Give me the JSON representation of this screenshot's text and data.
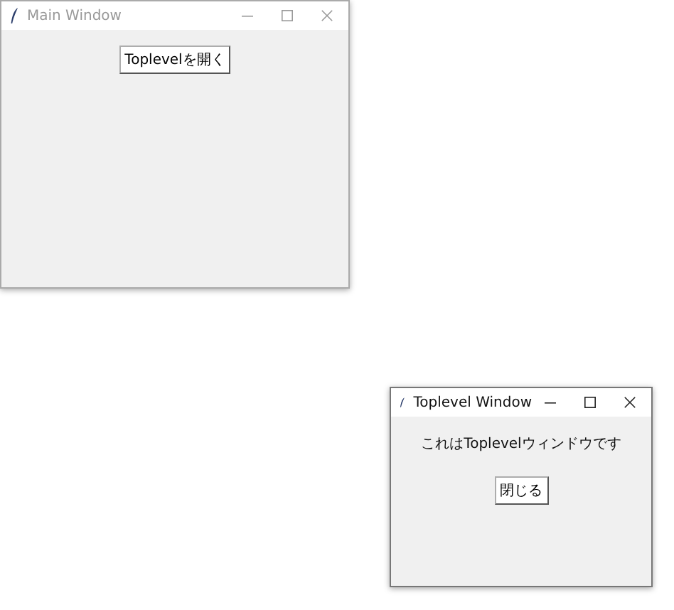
{
  "windows": [
    {
      "title": "Main Window",
      "active": false,
      "content": [
        {
          "kind": "button",
          "text": "Toplevelを開く"
        }
      ]
    },
    {
      "title": "Toplevel Window",
      "active": true,
      "content": [
        {
          "kind": "label",
          "text": "これはToplevelウィンドウです"
        },
        {
          "kind": "button",
          "text": "閉じる"
        }
      ]
    }
  ]
}
